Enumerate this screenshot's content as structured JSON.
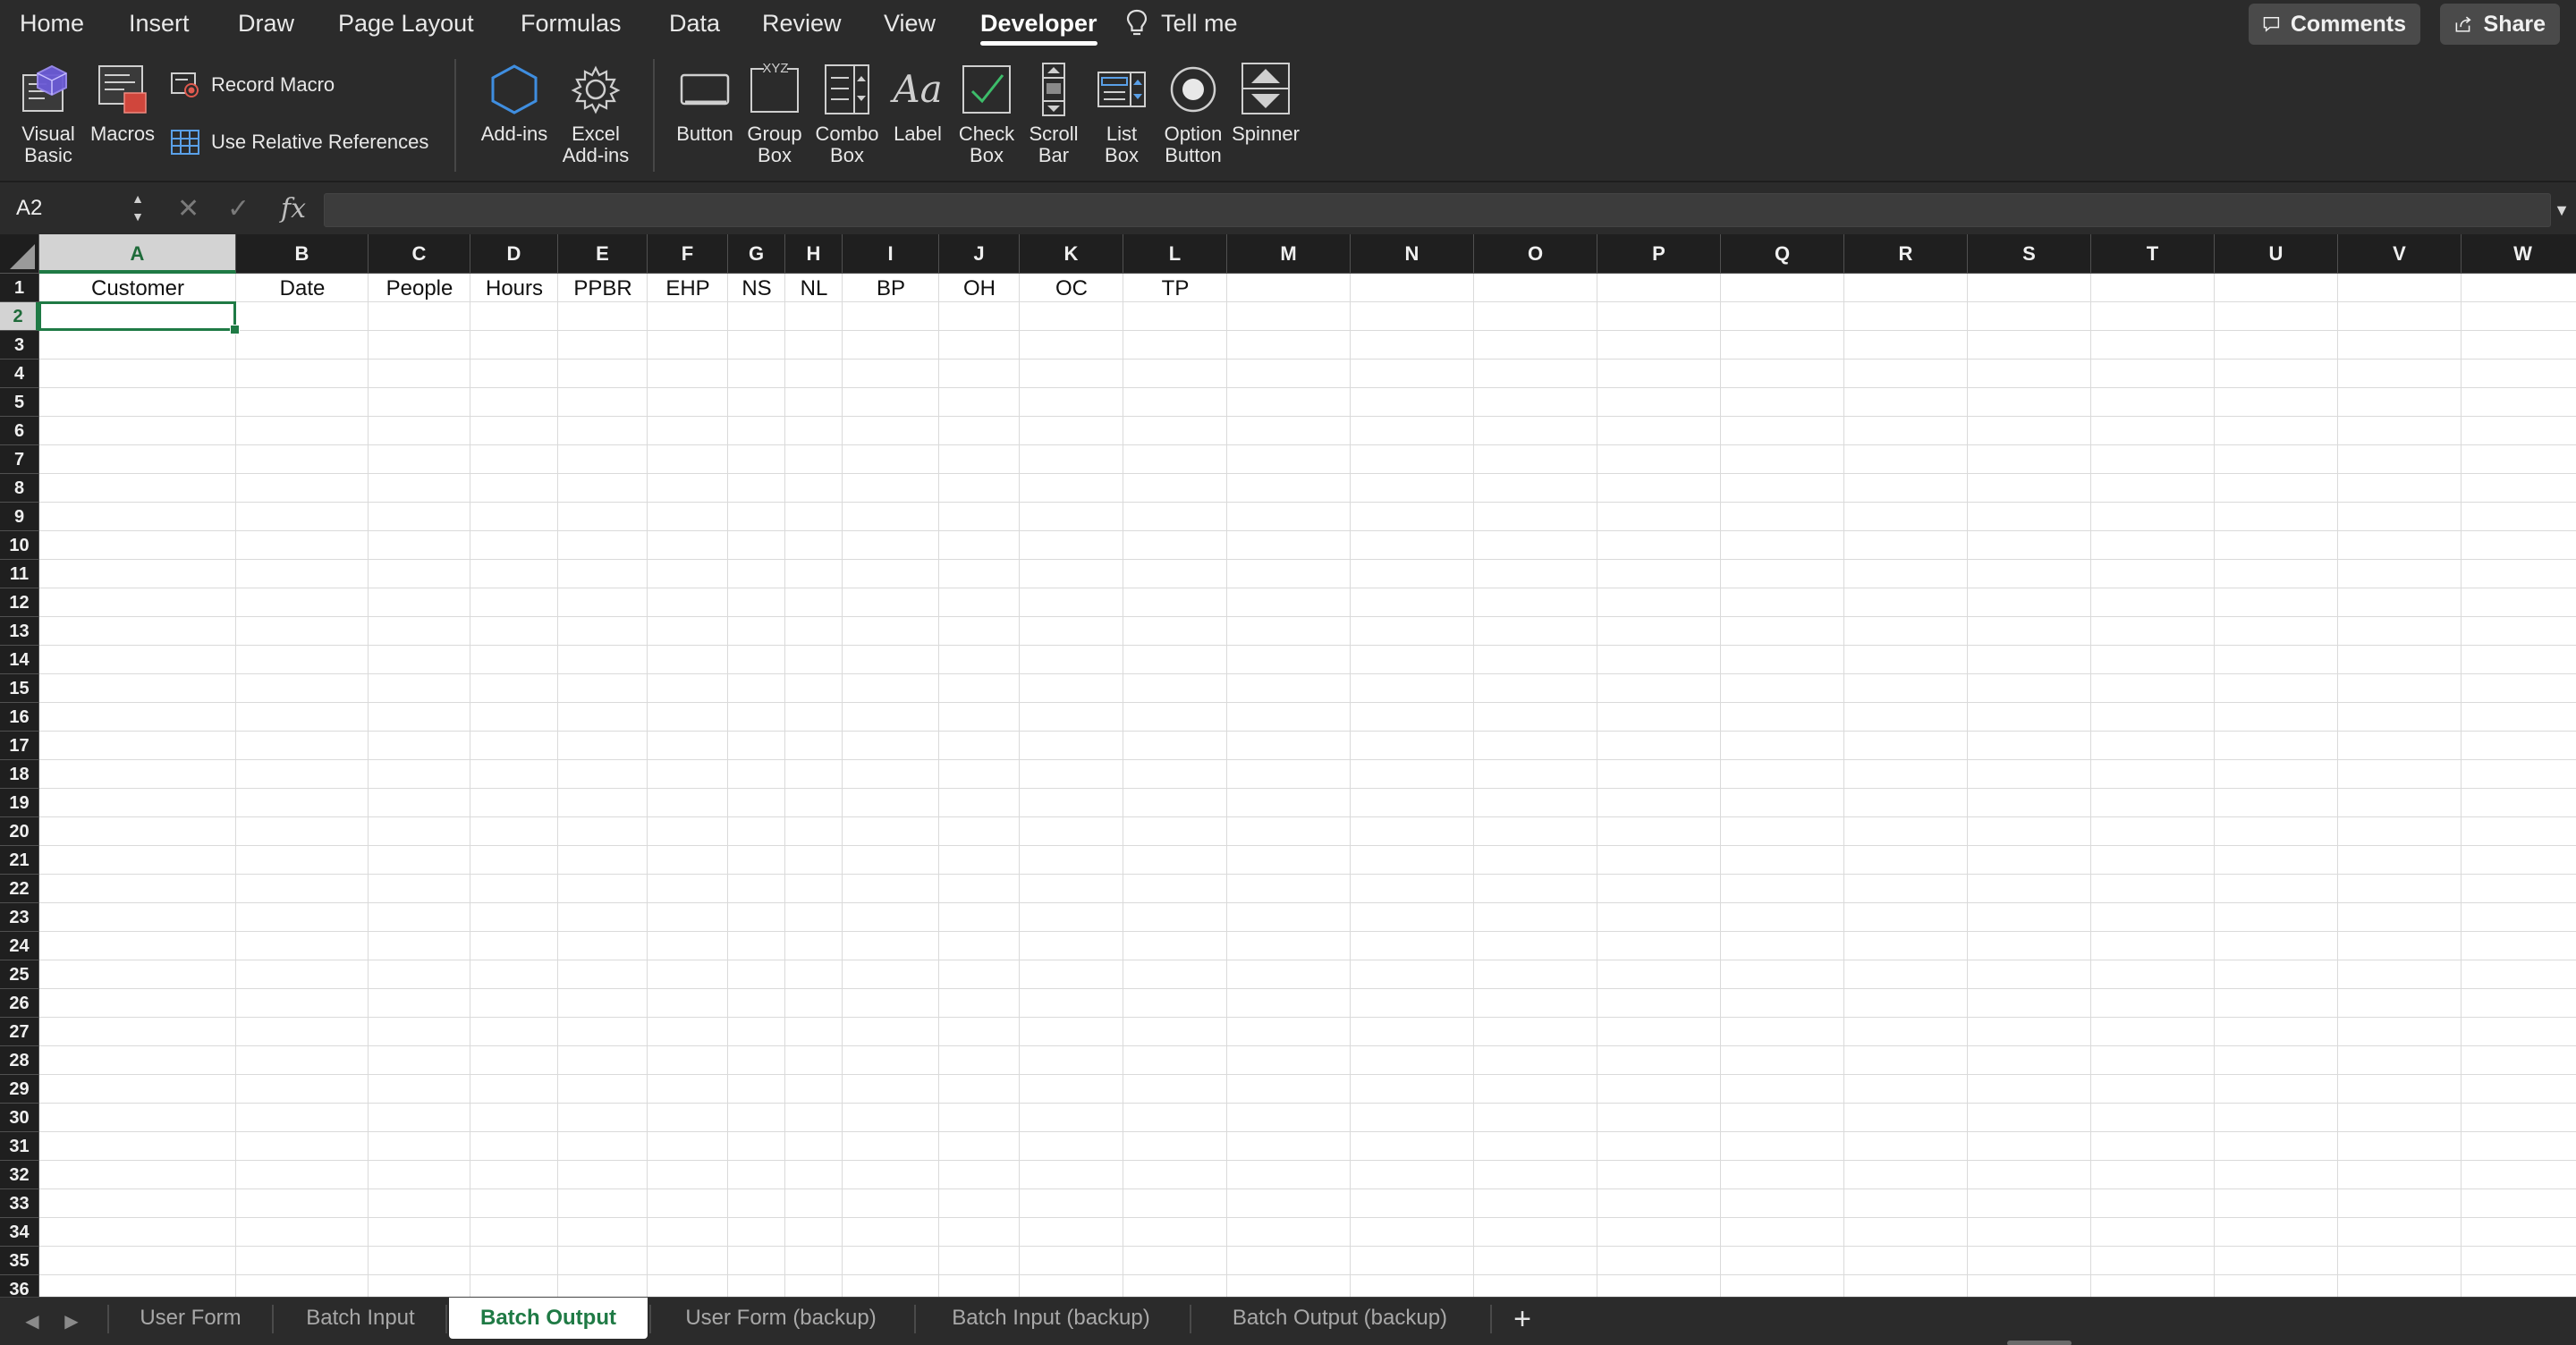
{
  "ribbon_tabs": [
    "Home",
    "Insert",
    "Draw",
    "Page Layout",
    "Formulas",
    "Data",
    "Review",
    "View",
    "Developer"
  ],
  "active_ribbon_tab": "Developer",
  "tell_me": "Tell me",
  "comments_label": "Comments",
  "share_label": "Share",
  "ribbon": {
    "visual_basic": "Visual\nBasic",
    "macros": "Macros",
    "record_macro": "Record Macro",
    "use_relative_references": "Use Relative References",
    "add_ins": "Add-ins",
    "excel_add_ins": "Excel\nAdd-ins",
    "button": "Button",
    "group_box": "Group\nBox",
    "combo_box": "Combo\nBox",
    "label": "Label",
    "check_box": "Check\nBox",
    "scroll_bar": "Scroll\nBar",
    "list_box": "List\nBox",
    "option_button": "Option\nButton",
    "spinner": "Spinner"
  },
  "formula_bar": {
    "name_box": "A2",
    "fx": "fx",
    "formula": ""
  },
  "columns": [
    "A",
    "B",
    "C",
    "D",
    "E",
    "F",
    "G",
    "H",
    "I",
    "J",
    "K",
    "L",
    "M",
    "N",
    "O",
    "P",
    "Q",
    "R",
    "S",
    "T",
    "U",
    "V",
    "W"
  ],
  "row_count": 36,
  "header_row": [
    "Customer",
    "Date",
    "People",
    "Hours",
    "PPBR",
    "EHP",
    "NS",
    "NL",
    "BP",
    "OH",
    "OC",
    "TP"
  ],
  "active_cell": "A2",
  "sheet_tabs": [
    "User Form",
    "Batch Input",
    "Batch Output",
    "User Form (backup)",
    "Batch Input (backup)",
    "Batch Output (backup)"
  ],
  "active_sheet": "Batch Output",
  "colors": {
    "accent_green": "#1f7a45",
    "ribbon_bg": "#2b2b2b",
    "header_bg": "#1f1f1f"
  }
}
